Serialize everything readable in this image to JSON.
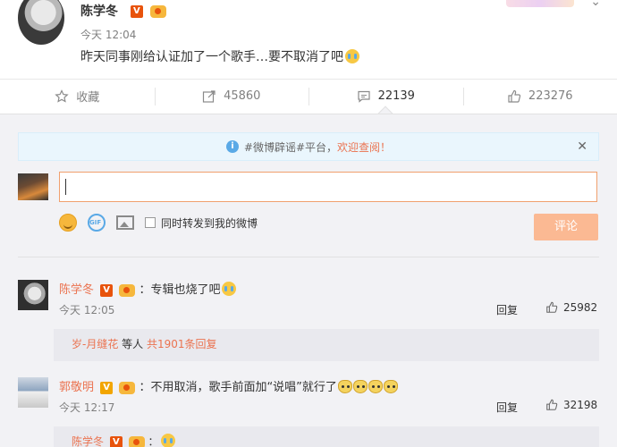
{
  "post": {
    "author": "陈学冬",
    "time": "今天 12:04",
    "text": "昨天同事刚给认证加了一个歌手…要不取消了吧"
  },
  "actions": {
    "favorite": "收藏",
    "repost": "45860",
    "comment": "22139",
    "like": "223276"
  },
  "notice": {
    "prefix": "#微博辟谣#平台，",
    "link": "欢迎查阅！"
  },
  "composer": {
    "input_value": "",
    "repost_label": "同时转发到我的微博",
    "submit_label": "评论"
  },
  "comments": [
    {
      "name": "陈学冬",
      "text": "：专辑也烧了吧",
      "time": "今天 12:05",
      "reply_label": "回复",
      "likes": "25982",
      "sub": {
        "name": "岁-月缝花",
        "mid": " 等人 ",
        "count": "共1901条回复"
      }
    },
    {
      "name": "郭敬明",
      "text": "：不用取消，歌手前面加“说唱”就行了",
      "time": "今天 12:17",
      "reply_label": "回复",
      "likes": "32198",
      "sub": {
        "name": "陈学冬",
        "text": "："
      }
    }
  ],
  "colors": {
    "accent": "#eb7350",
    "submit_disabled": "#fbb993",
    "panel_bg": "#f2f2f5"
  }
}
